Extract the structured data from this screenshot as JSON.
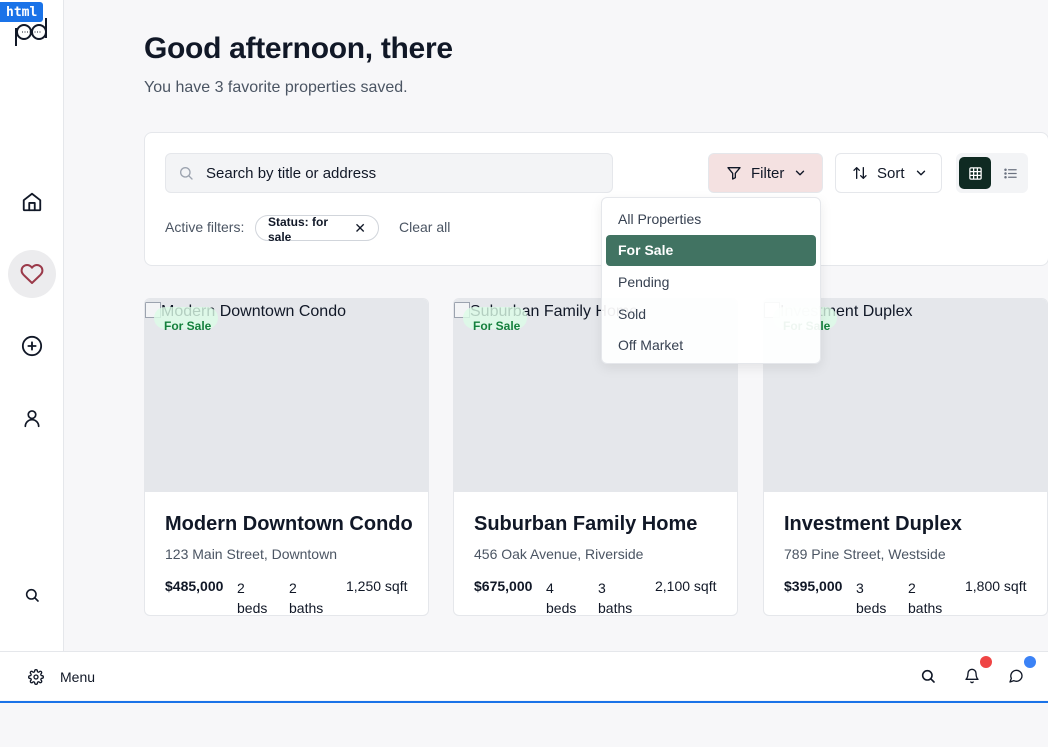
{
  "badge": "html",
  "header": {
    "greeting": "Good afternoon, there",
    "subtitle": "You have 3 favorite properties saved."
  },
  "toolbar": {
    "search_placeholder": "Search by title or address",
    "filter_label": "Filter",
    "sort_label": "Sort"
  },
  "filters": {
    "active_label": "Active filters:",
    "chip": "Status: for sale",
    "clear": "Clear all"
  },
  "dropdown": {
    "items": [
      "All Properties",
      "For Sale",
      "Pending",
      "Sold",
      "Off Market"
    ],
    "selected": "For Sale"
  },
  "properties": [
    {
      "image_alt": "Modern Downtown Condo",
      "badge": "For Sale",
      "title": "Modern Downtown Condo",
      "address": "123 Main Street, Downtown",
      "price": "$485,000",
      "beds": "2 beds",
      "baths": "2 baths",
      "sqft": "1,250 sqft"
    },
    {
      "image_alt": "Suburban Family Home",
      "badge": "For Sale",
      "title": "Suburban Family Home",
      "address": "456 Oak Avenue, Riverside",
      "price": "$675,000",
      "beds": "4 beds",
      "baths": "3 baths",
      "sqft": "2,100 sqft"
    },
    {
      "image_alt": "Investment Duplex",
      "badge": "For Sale",
      "title": "Investment Duplex",
      "address": "789 Pine Street, Westside",
      "price": "$395,000",
      "beds": "3 beds",
      "baths": "2 baths",
      "sqft": "1,800 sqft"
    }
  ],
  "bottombar": {
    "menu_label": "Menu"
  },
  "colors": {
    "accent": "#417362",
    "dark": "#0f2a22",
    "notification_red": "#ef4444",
    "notification_blue": "#3b82f6",
    "filter_bg": "#f4e1e1"
  }
}
